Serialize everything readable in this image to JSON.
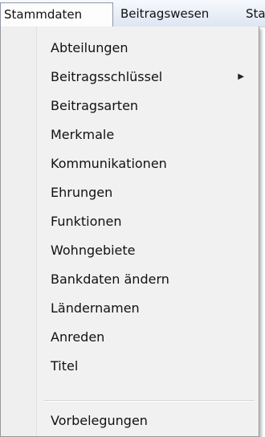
{
  "menubar": {
    "items": [
      "Stammdaten",
      "Beitragswesen",
      "Sta"
    ]
  },
  "dropdown": {
    "items": [
      {
        "label": "Abteilungen"
      },
      {
        "label": "Beitragsschlüssel",
        "submenu_icon": "submenu-arrow-icon"
      },
      {
        "label": "Beitragsarten"
      },
      {
        "label": "Merkmale"
      },
      {
        "label": "Kommunikationen"
      },
      {
        "label": "Ehrungen"
      },
      {
        "label": "Funktionen"
      },
      {
        "label": "Wohngebiete"
      },
      {
        "label": "Bankdaten ändern"
      },
      {
        "label": "Ländernamen"
      },
      {
        "label": "Anreden"
      },
      {
        "label": "Titel"
      },
      {
        "label": "Vorbelegungen"
      }
    ]
  }
}
